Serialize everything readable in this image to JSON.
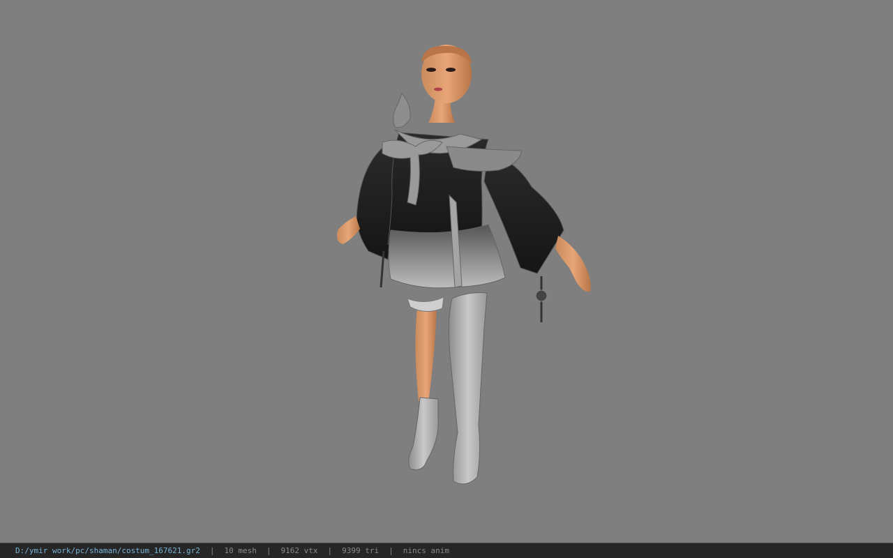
{
  "viewport": {
    "background_color": "#7f7f7f",
    "model_description_icon": "character-model-icon"
  },
  "status_bar": {
    "file_path": "D:/ymir work/pc/shaman/costum_167621.gr2",
    "mesh_count": "10 mesh",
    "vertex_count": "9162 vtx",
    "triangle_count": "9399 tri",
    "animation": "nincs anim",
    "separator": "|",
    "path_color": "#79b4d8",
    "text_color": "#8a8a8a"
  }
}
